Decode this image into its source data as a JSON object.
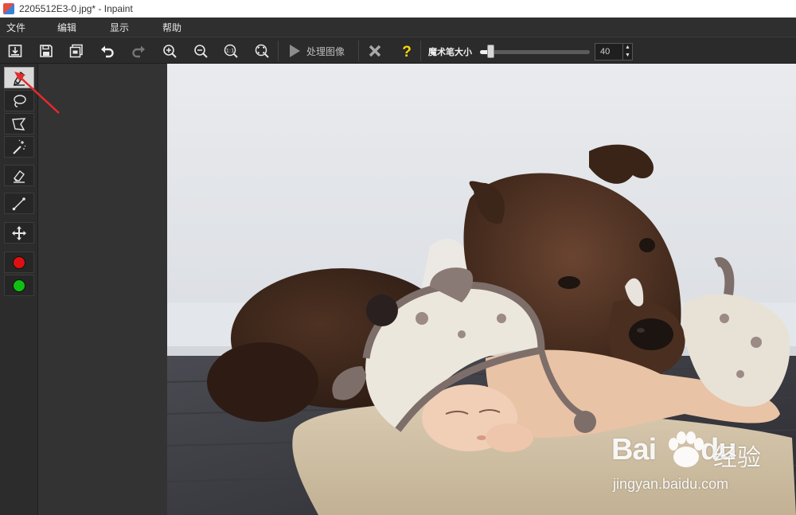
{
  "window": {
    "title": "2205512E3-0.jpg* - Inpaint"
  },
  "menu": {
    "items": [
      "文件",
      "编辑",
      "显示",
      "帮助"
    ]
  },
  "toolbar": {
    "buttons": [
      "open-icon",
      "save-icon",
      "save-as-icon",
      "undo-icon",
      "redo-icon",
      "zoom-in-icon",
      "zoom-out-icon",
      "zoom-actual-icon",
      "zoom-fit-icon"
    ],
    "process_label": "处理图像",
    "cancel_icon": "x-icon",
    "help_icon": "question-icon",
    "brush_label": "魔术笔大小",
    "brush_size": "40",
    "brush_slider_fraction": 0.1
  },
  "tools": [
    {
      "name": "marker",
      "icon": "marker-icon",
      "active": true
    },
    {
      "name": "lasso",
      "icon": "lasso-icon",
      "active": false
    },
    {
      "name": "polygon-lasso",
      "icon": "polygon-lasso-icon",
      "active": false
    },
    {
      "name": "magic-wand",
      "icon": "magic-wand-icon",
      "active": false
    },
    {
      "name": "eraser",
      "icon": "eraser-icon",
      "active": false
    },
    {
      "name": "line",
      "icon": "line-icon",
      "active": false
    },
    {
      "name": "move",
      "icon": "move-icon",
      "active": false
    }
  ],
  "colors": {
    "red_marker": "#e01010",
    "green_marker": "#10c010",
    "accent_help": "#f5d90a",
    "annotation_arrow": "#e8292b"
  },
  "watermark": {
    "brand": "Bai",
    "brand_suffix": "du",
    "cn": "经验",
    "url": "jingyan.baidu.com"
  }
}
